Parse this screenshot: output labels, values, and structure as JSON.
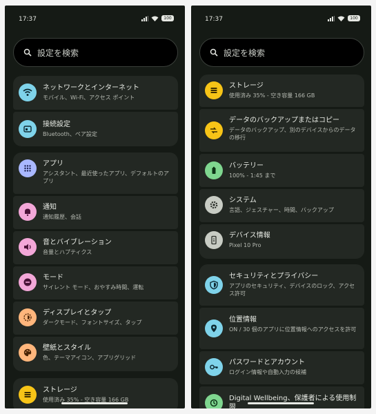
{
  "status": {
    "time": "17:37",
    "battery": "100"
  },
  "search": {
    "placeholder": "設定を検索"
  },
  "left": {
    "groups": [
      [
        {
          "title": "ネットワークとインターネット",
          "sub": "モバイル、Wi-Fi、アクセス ポイント",
          "icon": "wifi-icon",
          "color": "#7fd3ea"
        },
        {
          "title": "接続設定",
          "sub": "Bluetooth、ペア設定",
          "icon": "devices-icon",
          "color": "#7fd3ea"
        }
      ],
      [
        {
          "title": "アプリ",
          "sub": "アシスタント、最近使ったアプリ、デフォルトのアプリ",
          "icon": "apps-grid-icon",
          "color": "#a9b8ff"
        },
        {
          "title": "通知",
          "sub": "通知履歴、会話",
          "icon": "bell-icon",
          "color": "#f3a7d8"
        },
        {
          "title": "音とバイブレーション",
          "sub": "音量とハプティクス",
          "icon": "speaker-icon",
          "color": "#f3a7d8"
        },
        {
          "title": "モード",
          "sub": "サイレント モード、おやすみ時間、運転",
          "icon": "mode-icon",
          "color": "#f3a7d8"
        },
        {
          "title": "ディスプレイとタップ",
          "sub": "ダークモード、フォントサイズ、タップ",
          "icon": "brightness-icon",
          "color": "#ffb67c"
        },
        {
          "title": "壁紙とスタイル",
          "sub": "色、テーマアイコン、アプリグリッド",
          "icon": "palette-icon",
          "color": "#ffb67c"
        }
      ],
      [
        {
          "title": "ストレージ",
          "sub": "使用済み 35% - 空き容量 166 GB",
          "icon": "storage-icon",
          "color": "#f7c417"
        }
      ]
    ]
  },
  "right": {
    "groups": [
      [
        {
          "title": "ストレージ",
          "sub": "使用済み 35% - 空き容量 166 GB",
          "icon": "storage-icon",
          "color": "#f7c417"
        },
        {
          "title": "データのバックアップまたはコピー",
          "sub": "データのバックアップ、別のデバイスからのデータの移行",
          "icon": "transfer-icon",
          "color": "#f7c417"
        },
        {
          "title": "バッテリー",
          "sub": "100% - 1:45 まで",
          "icon": "battery-icon",
          "color": "#7fd68f"
        },
        {
          "title": "システム",
          "sub": "言語、ジェスチャー、時間、バックアップ",
          "icon": "gear-icon",
          "color": "#c8ccc4"
        },
        {
          "title": "デバイス情報",
          "sub": "Pixel 10 Pro",
          "icon": "phone-info-icon",
          "color": "#c8ccc4"
        }
      ],
      [
        {
          "title": "セキュリティとプライバシー",
          "sub": "アプリのセキュリティ、デバイスのロック、アクセス許可",
          "icon": "shield-icon",
          "color": "#7fd3ea"
        },
        {
          "title": "位置情報",
          "sub": "ON / 30 個のアプリに位置情報へのアクセスを許可",
          "icon": "location-icon",
          "color": "#7fd3ea"
        },
        {
          "title": "パスワードとアカウント",
          "sub": "ログイン情報や自動入力の候補",
          "icon": "key-icon",
          "color": "#7fd3ea"
        },
        {
          "title": "Digital Wellbeing、保護者による使用制限",
          "sub": "",
          "icon": "wellbeing-icon",
          "color": "#7fd68f"
        }
      ]
    ]
  }
}
